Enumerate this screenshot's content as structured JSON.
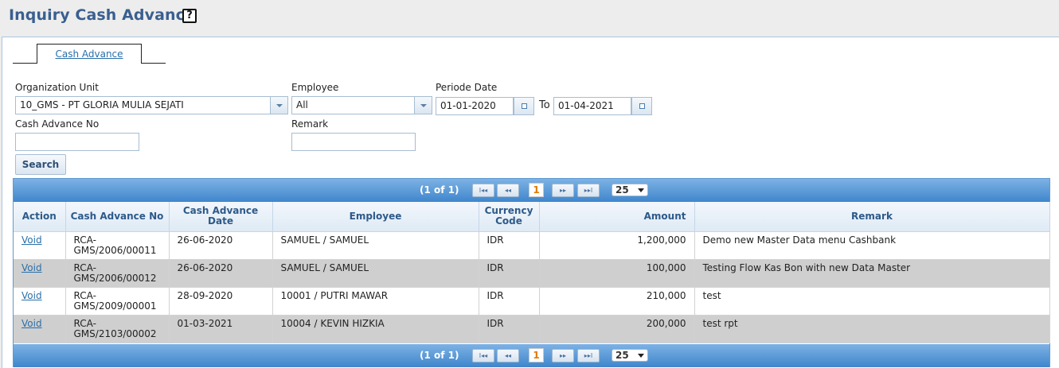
{
  "page": {
    "title": "Inquiry Cash Advance",
    "help_label": "?"
  },
  "tabs": [
    {
      "label": "Cash Advance"
    }
  ],
  "filters": {
    "org_unit_label": "Organization Unit",
    "org_unit_value": "10_GMS - PT GLORIA MULIA SEJATI",
    "employee_label": "Employee",
    "employee_value": "All",
    "period_label": "Periode Date",
    "period_from": "01-01-2020",
    "period_to_label": "To",
    "period_to": "01-04-2021",
    "cash_advance_no_label": "Cash Advance No",
    "cash_advance_no_value": "",
    "remark_label": "Remark",
    "remark_value": "",
    "search_label": "Search"
  },
  "pager": {
    "status": "(1 of 1)",
    "first": "I◂◂",
    "prev": "◂◂",
    "page": "1",
    "next": "▸▸",
    "last": "▸▸I",
    "rows_per_page": "25"
  },
  "grid": {
    "columns": [
      "Action",
      "Cash Advance No",
      "Cash Advance Date",
      "Employee",
      "Currency Code",
      "Amount",
      "Remark"
    ],
    "rows": [
      {
        "action": "Void",
        "no": "RCA-GMS/2006/00011",
        "date": "26-06-2020",
        "employee": "SAMUEL / SAMUEL",
        "currency": "IDR",
        "amount": "1,200,000",
        "remark": "Demo new Master Data menu Cashbank"
      },
      {
        "action": "Void",
        "no": "RCA-GMS/2006/00012",
        "date": "26-06-2020",
        "employee": "SAMUEL / SAMUEL",
        "currency": "IDR",
        "amount": "100,000",
        "remark": "Testing Flow Kas Bon with new Data Master"
      },
      {
        "action": "Void",
        "no": "RCA-GMS/2009/00001",
        "date": "28-09-2020",
        "employee": "10001 / PUTRI MAWAR",
        "currency": "IDR",
        "amount": "210,000",
        "remark": "test"
      },
      {
        "action": "Void",
        "no": "RCA-GMS/2103/00002",
        "date": "01-03-2021",
        "employee": "10004 / KEVIN HIZKIA",
        "currency": "IDR",
        "amount": "200,000",
        "remark": "test rpt"
      }
    ]
  }
}
